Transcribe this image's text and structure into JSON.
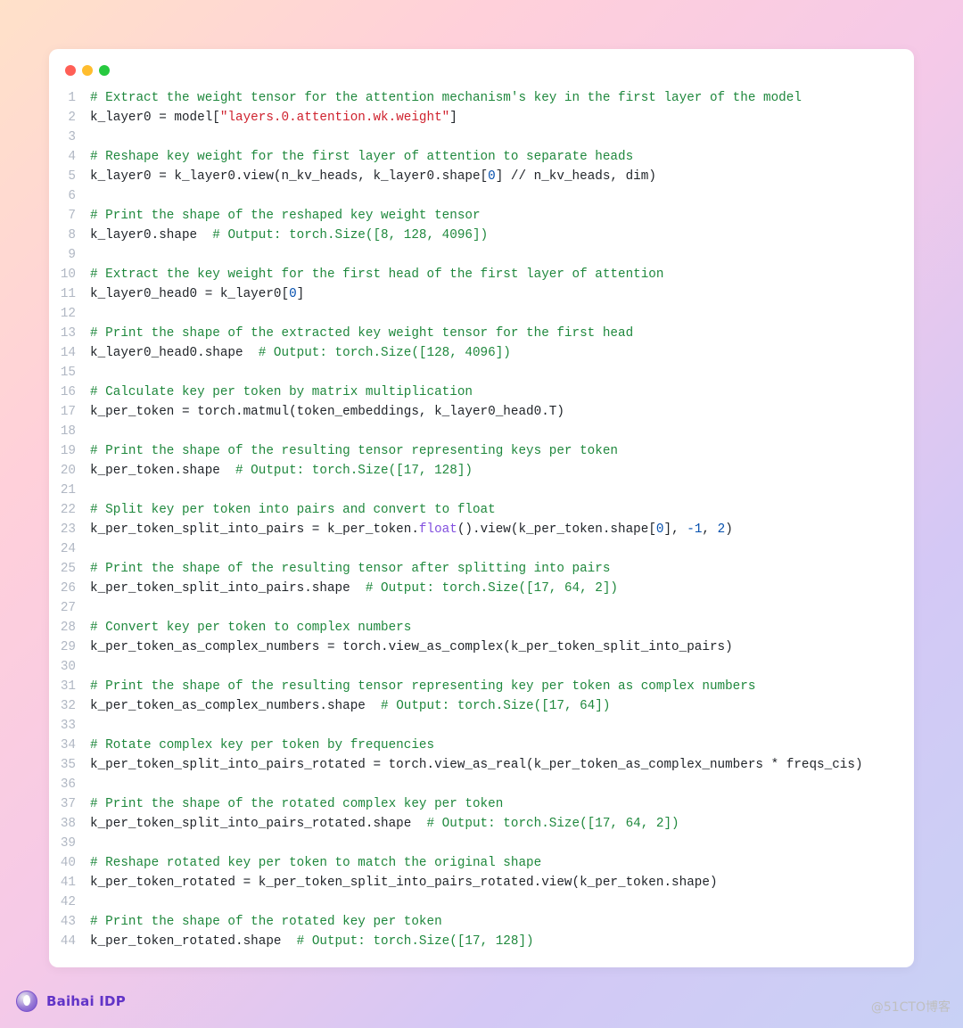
{
  "footer": {
    "brand": "Baihai IDP"
  },
  "watermark": "@51CTO博客",
  "code": {
    "lines": [
      [
        {
          "c": "c",
          "t": "# Extract the weight tensor for the attention mechanism's key in the first layer of the model"
        }
      ],
      [
        {
          "c": "d",
          "t": "k_layer0 = model["
        },
        {
          "c": "s",
          "t": "\"layers.0.attention.wk.weight\""
        },
        {
          "c": "d",
          "t": "]"
        }
      ],
      [],
      [
        {
          "c": "c",
          "t": "# Reshape key weight for the first layer of attention to separate heads"
        }
      ],
      [
        {
          "c": "d",
          "t": "k_layer0 = k_layer0.view(n_kv_heads, k_layer0.shape["
        },
        {
          "c": "n",
          "t": "0"
        },
        {
          "c": "d",
          "t": "] // n_kv_heads, dim)"
        }
      ],
      [],
      [
        {
          "c": "c",
          "t": "# Print the shape of the reshaped key weight tensor"
        }
      ],
      [
        {
          "c": "d",
          "t": "k_layer0.shape  "
        },
        {
          "c": "c",
          "t": "# Output: torch.Size([8, 128, 4096])"
        }
      ],
      [],
      [
        {
          "c": "c",
          "t": "# Extract the key weight for the first head of the first layer of attention"
        }
      ],
      [
        {
          "c": "d",
          "t": "k_layer0_head0 = k_layer0["
        },
        {
          "c": "n",
          "t": "0"
        },
        {
          "c": "d",
          "t": "]"
        }
      ],
      [],
      [
        {
          "c": "c",
          "t": "# Print the shape of the extracted key weight tensor for the first head"
        }
      ],
      [
        {
          "c": "d",
          "t": "k_layer0_head0.shape  "
        },
        {
          "c": "c",
          "t": "# Output: torch.Size([128, 4096])"
        }
      ],
      [],
      [
        {
          "c": "c",
          "t": "# Calculate key per token by matrix multiplication"
        }
      ],
      [
        {
          "c": "d",
          "t": "k_per_token = torch.matmul(token_embeddings, k_layer0_head0.T)"
        }
      ],
      [],
      [
        {
          "c": "c",
          "t": "# Print the shape of the resulting tensor representing keys per token"
        }
      ],
      [
        {
          "c": "d",
          "t": "k_per_token.shape  "
        },
        {
          "c": "c",
          "t": "# Output: torch.Size([17, 128])"
        }
      ],
      [],
      [
        {
          "c": "c",
          "t": "# Split key per token into pairs and convert to float"
        }
      ],
      [
        {
          "c": "d",
          "t": "k_per_token_split_into_pairs = k_per_token."
        },
        {
          "c": "f",
          "t": "float"
        },
        {
          "c": "d",
          "t": "().view(k_per_token.shape["
        },
        {
          "c": "n",
          "t": "0"
        },
        {
          "c": "d",
          "t": "], "
        },
        {
          "c": "n",
          "t": "-1"
        },
        {
          "c": "d",
          "t": ", "
        },
        {
          "c": "n",
          "t": "2"
        },
        {
          "c": "d",
          "t": ")"
        }
      ],
      [],
      [
        {
          "c": "c",
          "t": "# Print the shape of the resulting tensor after splitting into pairs"
        }
      ],
      [
        {
          "c": "d",
          "t": "k_per_token_split_into_pairs.shape  "
        },
        {
          "c": "c",
          "t": "# Output: torch.Size([17, 64, 2])"
        }
      ],
      [],
      [
        {
          "c": "c",
          "t": "# Convert key per token to complex numbers"
        }
      ],
      [
        {
          "c": "d",
          "t": "k_per_token_as_complex_numbers = torch.view_as_complex(k_per_token_split_into_pairs)"
        }
      ],
      [],
      [
        {
          "c": "c",
          "t": "# Print the shape of the resulting tensor representing key per token as complex numbers"
        }
      ],
      [
        {
          "c": "d",
          "t": "k_per_token_as_complex_numbers.shape  "
        },
        {
          "c": "c",
          "t": "# Output: torch.Size([17, 64])"
        }
      ],
      [],
      [
        {
          "c": "c",
          "t": "# Rotate complex key per token by frequencies"
        }
      ],
      [
        {
          "c": "d",
          "t": "k_per_token_split_into_pairs_rotated = torch.view_as_real(k_per_token_as_complex_numbers * freqs_cis)"
        }
      ],
      [],
      [
        {
          "c": "c",
          "t": "# Print the shape of the rotated complex key per token"
        }
      ],
      [
        {
          "c": "d",
          "t": "k_per_token_split_into_pairs_rotated.shape  "
        },
        {
          "c": "c",
          "t": "# Output: torch.Size([17, 64, 2])"
        }
      ],
      [],
      [
        {
          "c": "c",
          "t": "# Reshape rotated key per token to match the original shape"
        }
      ],
      [
        {
          "c": "d",
          "t": "k_per_token_rotated = k_per_token_split_into_pairs_rotated.view(k_per_token.shape)"
        }
      ],
      [],
      [
        {
          "c": "c",
          "t": "# Print the shape of the rotated key per token"
        }
      ],
      [
        {
          "c": "d",
          "t": "k_per_token_rotated.shape  "
        },
        {
          "c": "c",
          "t": "# Output: torch.Size([17, 128])"
        }
      ]
    ]
  }
}
